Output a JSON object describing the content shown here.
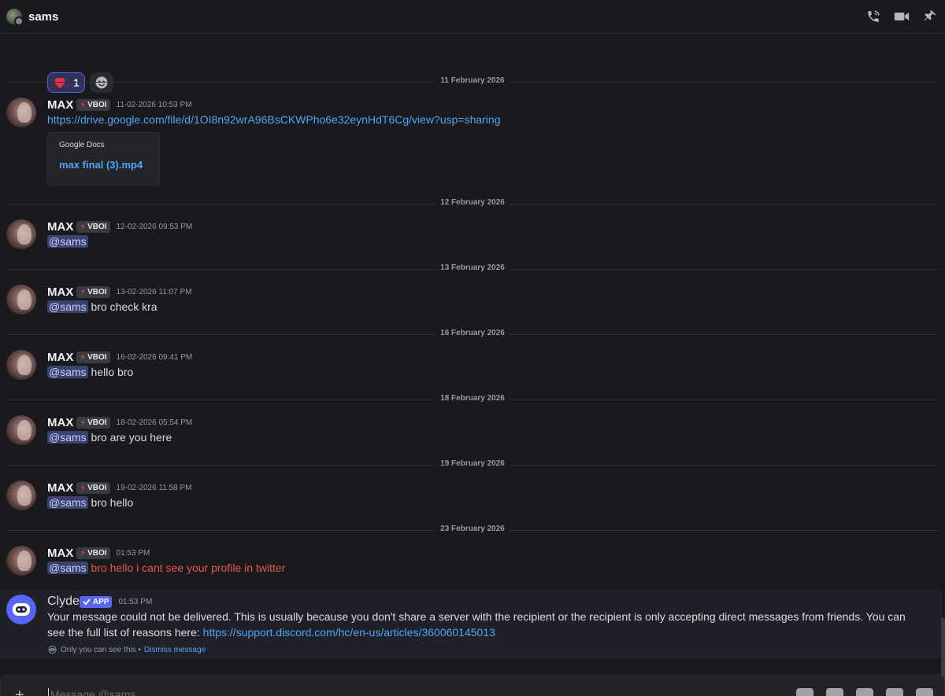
{
  "header": {
    "title": "sams"
  },
  "reactions": [
    {
      "emoji": "❤️",
      "count": "1"
    }
  ],
  "dividers": [
    "11 February 2026",
    "12 February 2026",
    "13 February 2026",
    "16 February 2026",
    "18 February 2026",
    "19 February 2026",
    "23 February 2026"
  ],
  "messages": [
    {
      "author": "MAX",
      "tag": "VBOI",
      "timestamp": "11-02-2026 10:53 PM",
      "link": "https://drive.google.com/file/d/1OI8n92wrA96BsCKWPho6e32eynHdT6Cg/view?usp=sharing",
      "embed": {
        "provider": "Google Docs",
        "title": "max final (3).mp4"
      }
    },
    {
      "author": "MAX",
      "tag": "VBOI",
      "timestamp": "12-02-2026 09:53 PM",
      "mention": "@sams",
      "text": ""
    },
    {
      "author": "MAX",
      "tag": "VBOI",
      "timestamp": "13-02-2026 11:07 PM",
      "mention": "@sams",
      "text": " bro check kra"
    },
    {
      "author": "MAX",
      "tag": "VBOI",
      "timestamp": "16-02-2026 09:41 PM",
      "mention": "@sams",
      "text": " hello bro"
    },
    {
      "author": "MAX",
      "tag": "VBOI",
      "timestamp": "18-02-2026 05:54 PM",
      "mention": "@sams",
      "text": " bro are you here"
    },
    {
      "author": "MAX",
      "tag": "VBOI",
      "timestamp": "19-02-2026 11:58 PM",
      "mention": "@sams",
      "text": " bro hello"
    },
    {
      "author": "MAX",
      "tag": "VBOI",
      "timestamp": "01:53 PM",
      "mention": "@sams",
      "text": " bro hello i cant see your profile in twitter"
    }
  ],
  "clyde": {
    "author": "Clyde",
    "tag": "APP",
    "timestamp": "01:53 PM",
    "text": "Your message could not be delivered. This is usually because you don't share a server with the recipient or the recipient is only accepting direct messages from friends. You can see the full list of reasons here: ",
    "link": "https://support.discord.com/hc/en-us/articles/360060145013",
    "ephemeral": "Only you can see this •",
    "dismiss": "Dismiss message"
  },
  "composer": {
    "placeholder": "Message @sams"
  },
  "colors": {
    "accent": "#5865f2",
    "link": "#4ea4f5",
    "failed_text": "#e4574c",
    "mention_bg": "#3c4270"
  }
}
